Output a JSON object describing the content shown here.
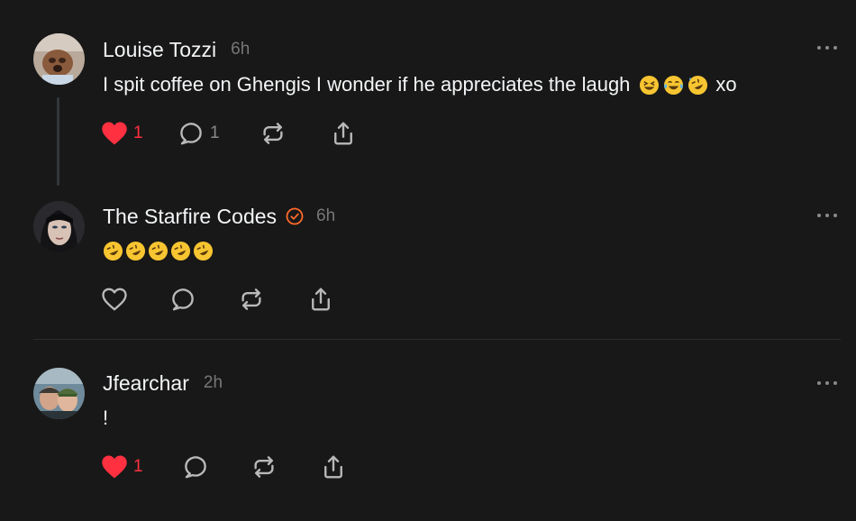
{
  "posts": [
    {
      "username": "Louise Tozzi",
      "time": "6h",
      "text": "I spit coffee on Ghengis I wonder if he appreciates the laugh",
      "emojis": [
        "grinning-squinting-face",
        "face-with-tears-of-joy",
        "rolling-on-floor-laughing"
      ],
      "text_suffix": "xo",
      "like_count": "1",
      "reply_count": "1",
      "liked": true
    },
    {
      "username": "The Starfire Codes",
      "verified": true,
      "time": "6h",
      "emojis": [
        "rolling-on-floor-laughing",
        "rolling-on-floor-laughing",
        "rolling-on-floor-laughing",
        "rolling-on-floor-laughing",
        "rolling-on-floor-laughing"
      ],
      "liked": false
    },
    {
      "username": "Jfearchar",
      "time": "2h",
      "text": "!",
      "like_count": "1",
      "liked": true
    }
  ],
  "colors": {
    "background": "#181818",
    "like_red": "#ff3040",
    "muted": "#777777",
    "verified_orange": "#ff6a2b"
  }
}
